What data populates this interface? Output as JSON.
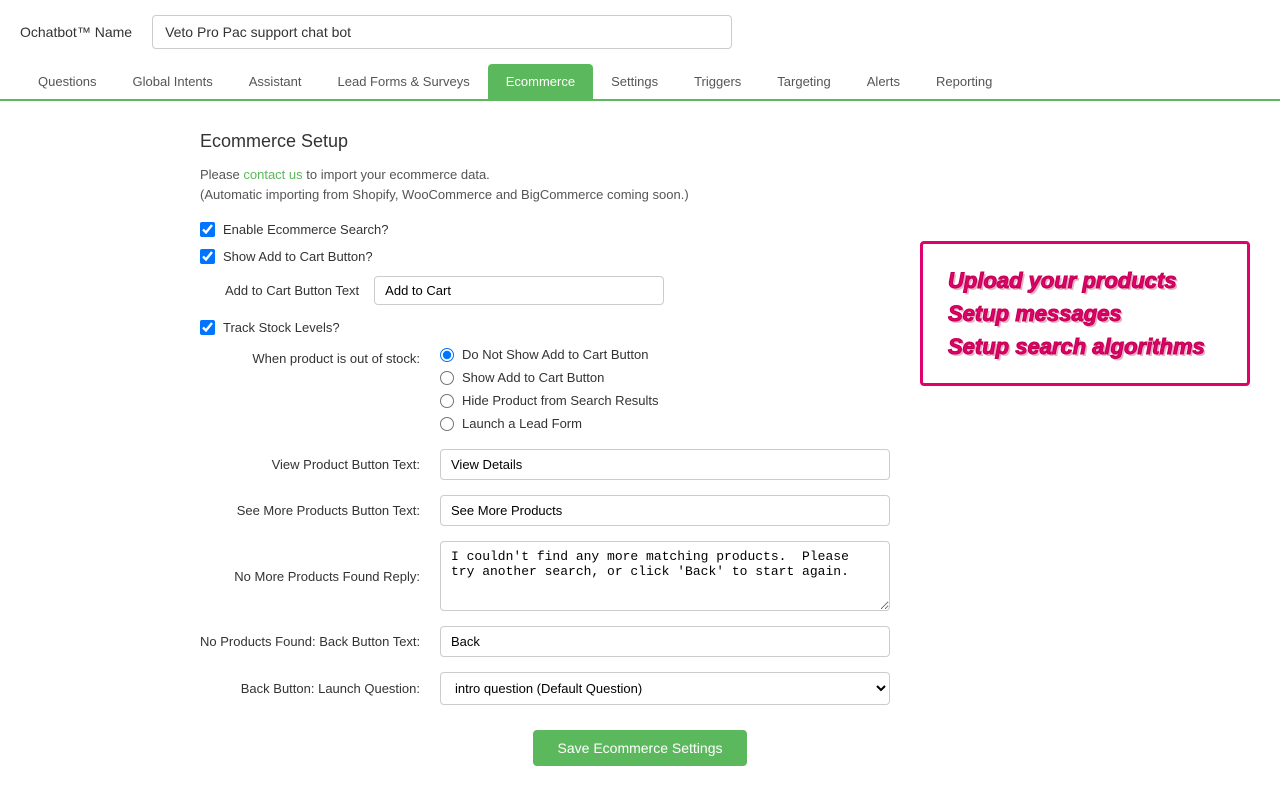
{
  "header": {
    "title": "Ochatbot™ Name",
    "bot_name_value": "Veto Pro Pac support chat bot",
    "bot_name_placeholder": "Veto Pro Pac support chat bot"
  },
  "nav": {
    "items": [
      {
        "label": "Questions",
        "active": false
      },
      {
        "label": "Global Intents",
        "active": false
      },
      {
        "label": "Assistant",
        "active": false
      },
      {
        "label": "Lead Forms & Surveys",
        "active": false
      },
      {
        "label": "Ecommerce",
        "active": true
      },
      {
        "label": "Settings",
        "active": false
      },
      {
        "label": "Triggers",
        "active": false
      },
      {
        "label": "Targeting",
        "active": false
      },
      {
        "label": "Alerts",
        "active": false
      },
      {
        "label": "Reporting",
        "active": false
      }
    ]
  },
  "main": {
    "section_title": "Ecommerce Setup",
    "description_pre": "Please",
    "description_link": "contact us",
    "description_post": "to import your ecommerce data.",
    "description_note": "(Automatic importing from Shopify, WooCommerce and BigCommerce coming soon.)",
    "promo": {
      "line1": "Upload your products",
      "line2": "Setup messages",
      "line3": "Setup search algorithms"
    },
    "enable_ecommerce_label": "Enable Ecommerce Search?",
    "show_add_to_cart_label": "Show Add to Cart Button?",
    "add_to_cart_button_text_label": "Add to Cart Button Text",
    "add_to_cart_button_text_value": "Add to Cart",
    "track_stock_label": "Track Stock Levels?",
    "out_of_stock_label": "When product is out of stock:",
    "out_of_stock_options": [
      {
        "label": "Do Not Show Add to Cart Button",
        "selected": true
      },
      {
        "label": "Show Add to Cart Button",
        "selected": false
      },
      {
        "label": "Hide Product from Search Results",
        "selected": false
      },
      {
        "label": "Launch a Lead Form",
        "selected": false
      }
    ],
    "view_product_label": "View Product Button Text:",
    "view_product_value": "View Details",
    "see_more_label": "See More Products Button Text:",
    "see_more_value": "See More Products",
    "no_more_products_label": "No More Products Found Reply:",
    "no_more_products_value": "I couldn't find any more matching products.  Please try another search, or click 'Back' to start again.",
    "no_products_back_label": "No Products Found: Back Button Text:",
    "no_products_back_value": "Back",
    "back_button_question_label": "Back Button: Launch Question:",
    "back_button_question_value": "intro question (Default Question)",
    "back_button_options": [
      "intro question (Default Question)"
    ],
    "save_button_label": "Save Ecommerce Settings"
  }
}
